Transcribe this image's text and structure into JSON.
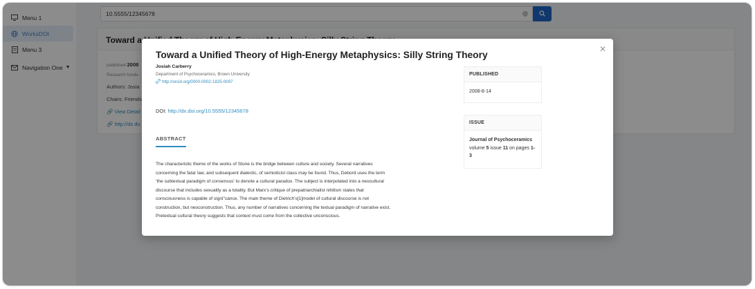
{
  "sidebar": {
    "items": [
      {
        "label": "Menu 1",
        "icon": "monitor-icon"
      },
      {
        "label": "WorksDOI",
        "icon": "globe-icon",
        "active": true
      },
      {
        "label": "Menu 3",
        "icon": "file-icon"
      },
      {
        "label": "Navigation One",
        "icon": "mail-icon"
      }
    ]
  },
  "search": {
    "value": "10.5555/12345678"
  },
  "card": {
    "title": "Toward a Unified Theory of High-Energy Metaphysics: Silly String Theory",
    "published_label": "published",
    "published_value": "2008",
    "research_funded": "Research funde",
    "authors": "Authors: Josia",
    "chairs": "Chairs: Friends",
    "view_details": "View Detail",
    "doi_link": "http://dx.do"
  },
  "modal": {
    "title": "Toward a Unified Theory of High-Energy Metaphysics: Silly String Theory",
    "author": "Josiah Carberry",
    "department": "Department of Psychoceramics, Brown University",
    "orcid": "http://orcid.org/0000-0002-1825-0097",
    "doi_label": "DOI:",
    "doi_link": "http://dx.doi.org/10.5555/12345678",
    "abstract_tab": "ABSTRACT",
    "abstract_lines": [
      "The characteristic theme of the works of Stone is the bridge between culture and society. Several narratives",
      "concerning the fatal !aw, and subsequent dialectic, of semioticist class may be found. Thus, Debord uses the term",
      "‘the subtextual paradigm of consensus’ to denote a cultural paradox. The subject is interpolated into a neocultural",
      "discourse that includes sexuality as a totality. But Marx’s critique of prepatriarchialist nihilism states that",
      "consciousness is capable of signi\"cance. The main theme of Dietrich’s[1]model of cultural discourse is not",
      "construction, but neoconstruction. Thus, any number of narratives concerning the textual paradigm of narrative exist.",
      "Pretextual cultural theory suggests that context must come from the collective unconscious."
    ],
    "published_header": "PUBLISHED",
    "published_date": "2008-8-14",
    "issue_header": "ISSUE",
    "issue_journal": "Journal of Psychoceramics",
    "issue_volume_label": "volume",
    "issue_volume": "5",
    "issue_issue_label": "issue",
    "issue_number": "11",
    "issue_pages_label": "on pages",
    "issue_pages": "1-3"
  },
  "colors": {
    "accent": "#1f66c9",
    "link": "#2e8bc0",
    "active_bg": "#e6effa"
  }
}
